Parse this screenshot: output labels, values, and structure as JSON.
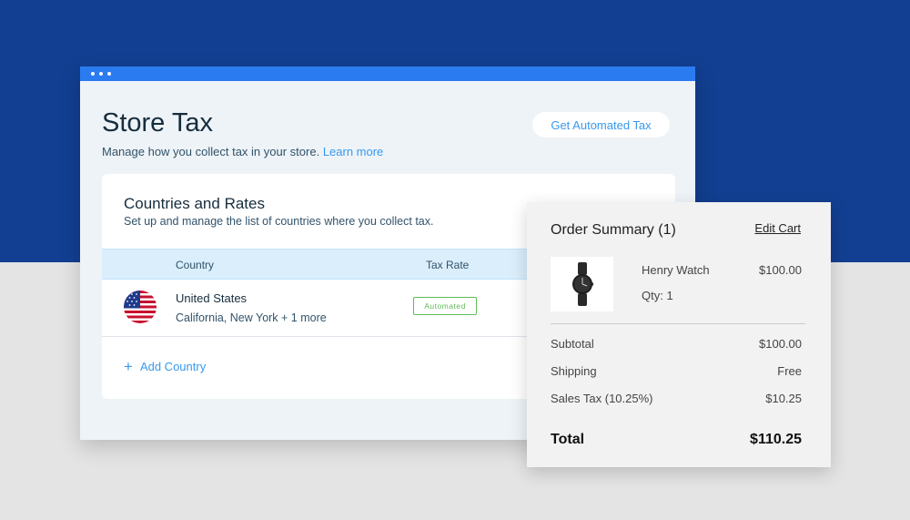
{
  "store_tax": {
    "title": "Store Tax",
    "subtitle": "Manage how you collect tax in your store.",
    "learn_more": "Learn more",
    "automated_button": "Get Automated Tax"
  },
  "rates_card": {
    "title": "Countries and Rates",
    "subtitle": "Set up and manage the list of countries where you collect tax.",
    "columns": [
      "Country",
      "Tax Rate"
    ],
    "rows": [
      {
        "flag_icon": "us-flag-icon",
        "country": "United States",
        "regions": "California, New York + 1 more",
        "tax_rate": "Automated"
      }
    ],
    "add_country": "Add Country"
  },
  "order_summary": {
    "title": "Order Summary (1)",
    "edit_cart": "Edit Cart",
    "product_icon": "watch-icon",
    "product": {
      "name": "Henry Watch",
      "price": "$100.00",
      "qty": "Qty: 1"
    },
    "lines": [
      {
        "label": "Subtotal",
        "value": "$100.00"
      },
      {
        "label": "Shipping",
        "value": "Free"
      },
      {
        "label": "Sales Tax (10.25%)",
        "value": "$10.25"
      }
    ],
    "total": {
      "label": "Total",
      "value": "$110.25"
    }
  },
  "colors": {
    "accent": "#3899ec",
    "window_bar": "#2b7bf0",
    "top_background": "#123f91",
    "badge_green": "#60bc57"
  }
}
